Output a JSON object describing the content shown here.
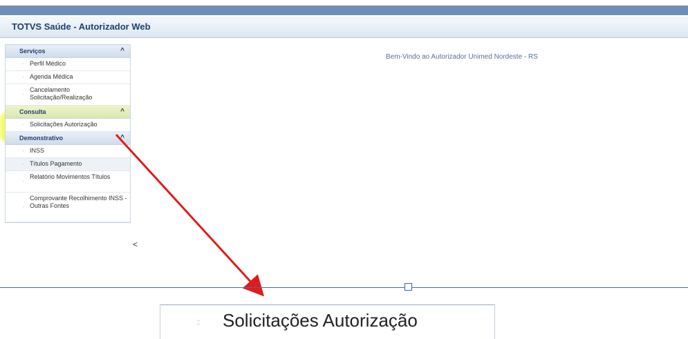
{
  "app": {
    "title": "TOTVS Saúde - Autorizador Web",
    "welcome": "Bem-Vindo ao Autorizador Unimed Nordeste - RS"
  },
  "sidebar": {
    "sections": [
      {
        "label": "Serviços",
        "items": [
          "Perfil Médico",
          "Agenda Médica",
          "Cancelamento Solicitação/Realização"
        ]
      },
      {
        "label": "Consulta",
        "items": [
          "Solicitações Autorização"
        ]
      },
      {
        "label": "Demonstrativo",
        "items": [
          "INSS",
          "Títulos Pagamento",
          "Relatório Movimentos Títulos",
          "Comprovante Recolhimento INSS - Outras Fontes"
        ]
      }
    ],
    "collapse_glyph": "<",
    "chevron_glyph": "^",
    "bullet_glyph": "·"
  },
  "zoom": {
    "label": "Solicitações Autorização",
    "handle_glyph": "::"
  },
  "colors": {
    "highlight": "#f0fa28",
    "arrow": "#e01b1b",
    "header_text": "#1f3f6b"
  }
}
